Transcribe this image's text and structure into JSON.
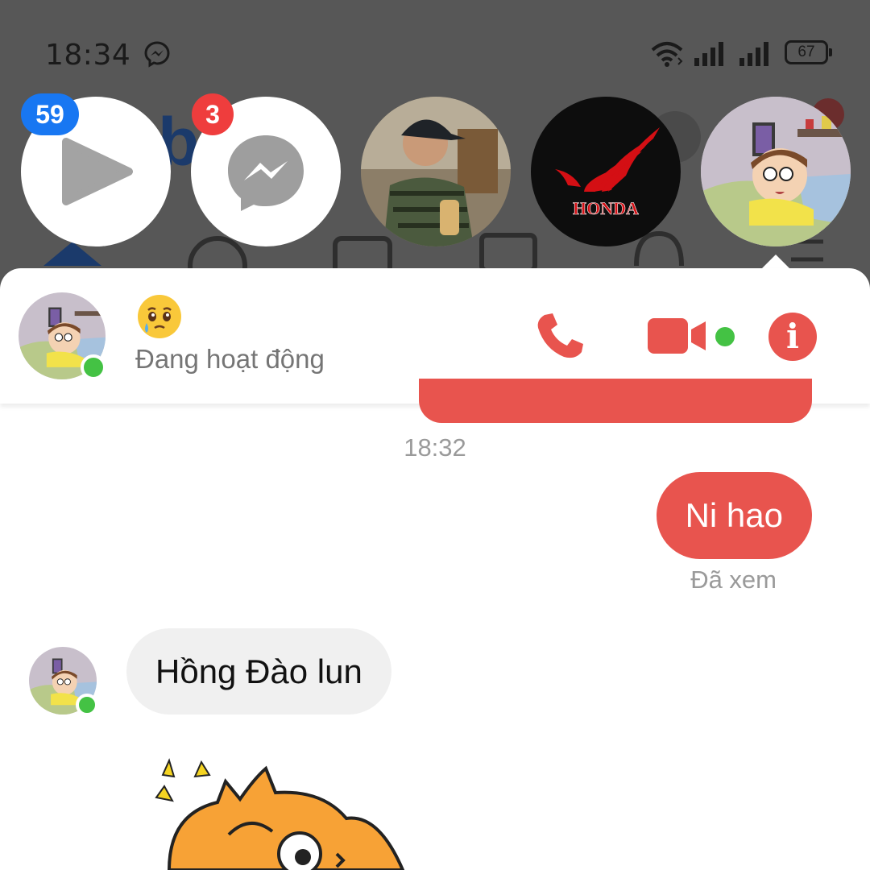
{
  "status_bar": {
    "time": "18:34",
    "battery": "67",
    "icons": [
      "messenger-icon",
      "wifi-icon",
      "signal-icon",
      "signal-icon",
      "battery-icon"
    ]
  },
  "chat_heads": [
    {
      "name": "video-chat-head",
      "icon": "play-icon",
      "badge": "59"
    },
    {
      "name": "messenger-chat-head",
      "icon": "messenger-icon",
      "badge": "3"
    },
    {
      "name": "person-chat-head",
      "icon": "photo-avatar"
    },
    {
      "name": "honda-chat-head",
      "icon": "honda-logo"
    },
    {
      "name": "morty-chat-head",
      "icon": "cartoon-avatar"
    }
  ],
  "chat": {
    "header": {
      "emoji": "🥹",
      "status": "Đang hoạt động",
      "actions": [
        "phone-icon",
        "video-camera-icon",
        "info-icon"
      ],
      "accent_color": "#e8544e",
      "online_color": "#44c244"
    },
    "timestamp": "18:32",
    "messages": {
      "sent": "Ni hao",
      "seen": "Đã xem",
      "received": "Hồng Đào lun"
    },
    "sticker": "orange-cat-sticker"
  }
}
